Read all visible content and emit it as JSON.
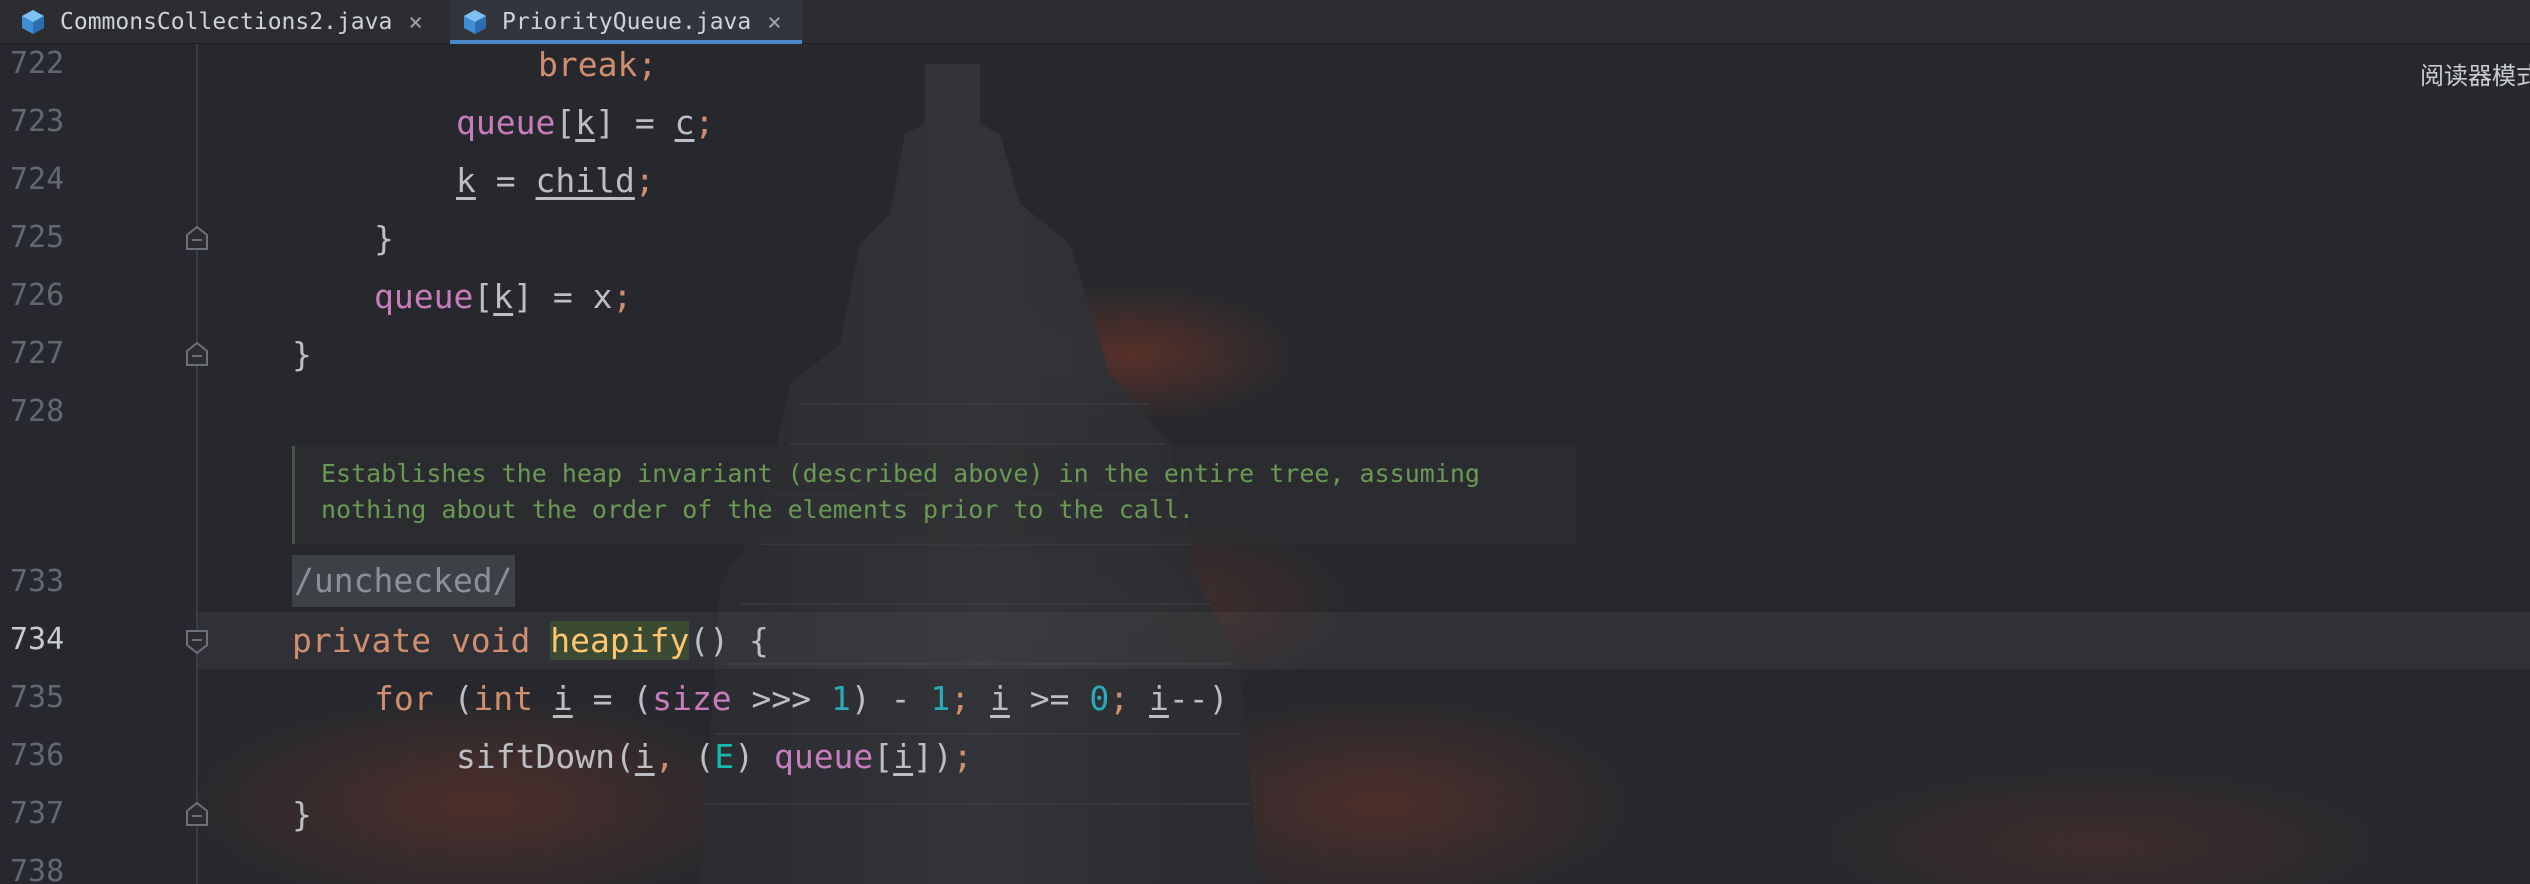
{
  "tabs": [
    {
      "label": "CommonsCollections2.java",
      "icon": "java-class-icon",
      "close": "×"
    },
    {
      "label": "PriorityQueue.java",
      "icon": "java-class-icon",
      "close": "×",
      "active": true
    }
  ],
  "reader_mode": "阅读器模式",
  "line_numbers": [
    "722",
    "723",
    "724",
    "725",
    "726",
    "727",
    "728",
    "733",
    "734",
    "735",
    "736",
    "737",
    "738"
  ],
  "code": {
    "l722": {
      "break": "break",
      "semi": ";"
    },
    "l723": {
      "field": "queue",
      "lb": "[",
      "idx": "k",
      "rb": "] = ",
      "val": "c",
      "semi": ";"
    },
    "l724": {
      "var": "k",
      "eq": " = ",
      "val": "child",
      "semi": ";"
    },
    "l725": {
      "brace": "}"
    },
    "l726": {
      "field": "queue",
      "lb": "[",
      "idx": "k",
      "rest": "] = x",
      "semi": ";"
    },
    "l727": {
      "brace": "}"
    },
    "l734": {
      "mod": "private void ",
      "name": "heapify",
      "rest": "() {"
    },
    "l735": {
      "for": "for",
      "open": " (",
      "int": "int",
      "sp": " ",
      "i1": "i",
      "assign": " = (",
      "size": "size",
      "shift": " >>> ",
      "one": "1",
      "minus": ") - ",
      "one2": "1",
      "semi1": ";",
      "sp2": " ",
      "i2": "i",
      "ge": " >= ",
      "zero": "0",
      "semi2": ";",
      "sp3": " ",
      "i3": "i",
      "dec": "--)"
    },
    "l736": {
      "call": "siftDown",
      "open": "(",
      "i1": "i",
      "comma": ",",
      "cast_open": " (",
      "type": "E",
      "cast_close": ") ",
      "field": "queue",
      "lb": "[",
      "i2": "i",
      "close": "])",
      "semi": ";"
    },
    "l737": {
      "brace": "}"
    }
  },
  "doc_comment": [
    "Establishes the heap invariant (described above) in the entire tree, assuming",
    "nothing about the order of the elements prior to the call."
  ],
  "annotation": "/unchecked/",
  "colors": {
    "keyword": "#cf8e6d",
    "field": "#c77dbb",
    "number": "#2aacb8",
    "declaration": "#ffc66d",
    "comment": "#6a9955",
    "active_tab_underline": "#4a88c7"
  }
}
